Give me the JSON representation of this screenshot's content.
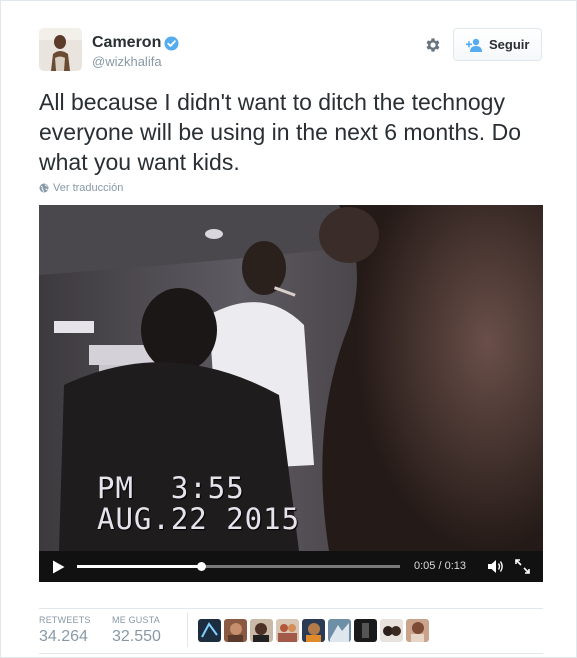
{
  "author": {
    "name": "Cameron",
    "handle": "@wizkhalifa",
    "verified": true,
    "avatar_icon": "user-avatar"
  },
  "actions": {
    "settings_icon": "gear-icon",
    "follow_label": "Seguir",
    "follow_icon": "add-user-icon"
  },
  "tweet": {
    "text": "All because I didn't want to ditch the technogy everyone will be using in the next 6 months. Do what you want kids.",
    "translate_label": "Ver traducción",
    "translate_icon": "globe-icon"
  },
  "video": {
    "overlay_time": "PM  3:55",
    "overlay_date": "AUG.22 2015",
    "time_display": "0:05 / 0:13",
    "progress": 0.385,
    "play_icon": "play-icon",
    "volume_icon": "volume-icon",
    "fullscreen_icon": "fullscreen-icon"
  },
  "stats": {
    "retweets_label": "RETWEETS",
    "retweets_value": "34.264",
    "likes_label": "ME GUSTA",
    "likes_value": "32.550",
    "likers_count_shown": 9
  },
  "colors": {
    "text": "#292f33",
    "muted": "#8899a6",
    "verified": "#55acee",
    "border": "#e1e8ed"
  }
}
